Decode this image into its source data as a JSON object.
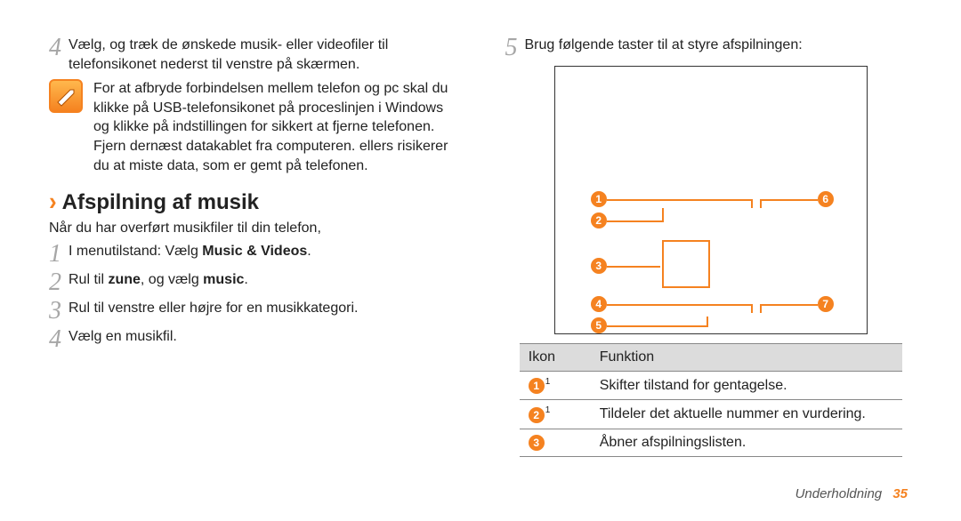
{
  "left": {
    "step4": "Vælg, og træk de ønskede musik- eller videofiler til telefonsikonet nederst til venstre på skærmen.",
    "note": "For at afbryde forbindelsen mellem telefon og pc skal du klikke på USB-telefonsikonet på proceslinjen i Windows og klikke på indstillingen for sikkert at fjerne telefonen. Fjern dernæst datakablet fra computeren. ellers risikerer du at miste data, som er gemt på telefonen.",
    "section_title": "Afspilning af musik",
    "intro": "Når du har overført musikfiler til din telefon,",
    "s1_pre": "I menutilstand: Vælg ",
    "s1_bold": "Music & Videos",
    "s1_post": ".",
    "s2_pre": "Rul til ",
    "s2_b1": "zune",
    "s2_mid": ", og vælg ",
    "s2_b2": "music",
    "s2_post": ".",
    "s3": "Rul til venstre eller højre for en musikkategori.",
    "s4": "Vælg en musikfil."
  },
  "right": {
    "step5": "Brug følgende taster til at styre afspilningen:",
    "callouts": {
      "c1": "1",
      "c2": "2",
      "c3": "3",
      "c4": "4",
      "c5": "5",
      "c6": "6",
      "c7": "7"
    },
    "table": {
      "h1": "Ikon",
      "h2": "Funktion",
      "rows": [
        {
          "n": "1",
          "fn": "1",
          "txt": "Skifter tilstand for gentagelse."
        },
        {
          "n": "2",
          "fn": "1",
          "txt": "Tildeler det aktuelle nummer en vurdering."
        },
        {
          "n": "3",
          "fn": "",
          "txt": "Åbner afspilningslisten."
        }
      ]
    }
  },
  "footer": {
    "section": "Underholdning",
    "page": "35"
  }
}
